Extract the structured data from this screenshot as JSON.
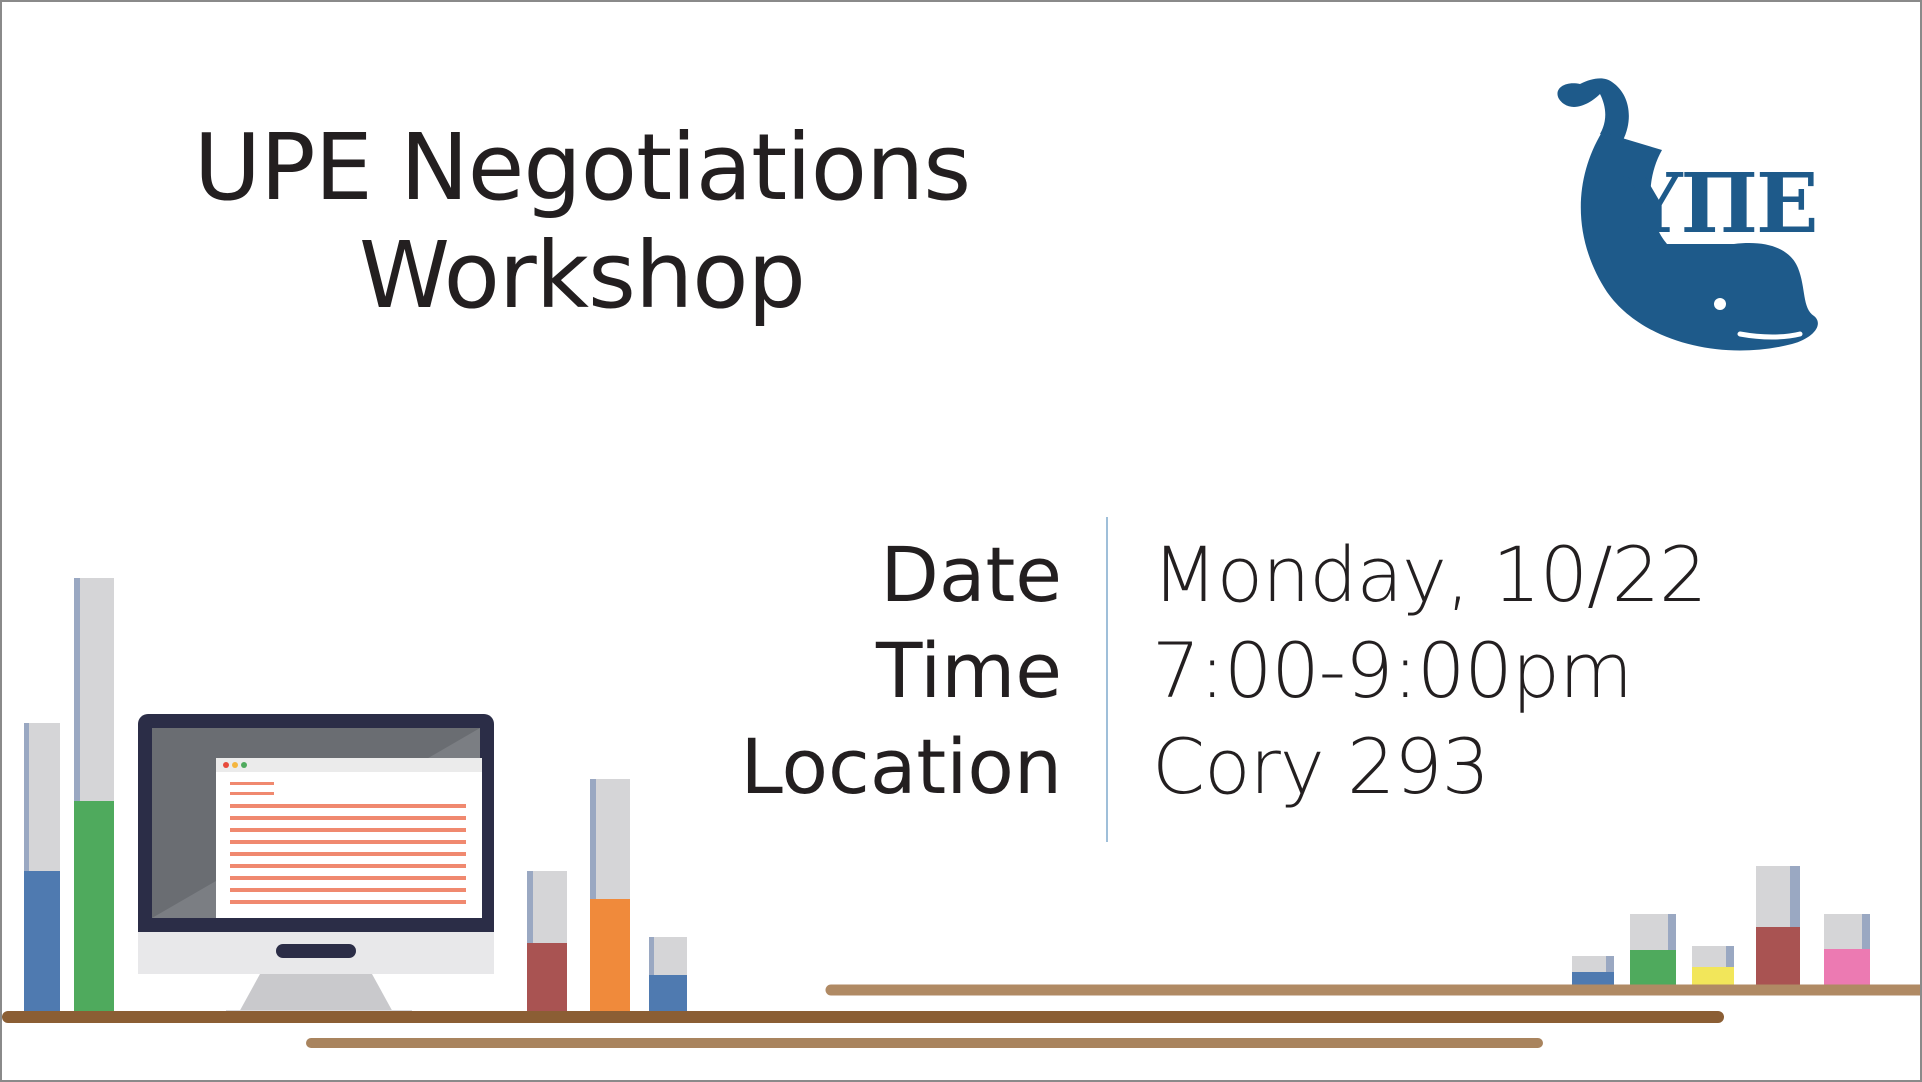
{
  "title": {
    "line1": "UPE Negotiations",
    "line2": "Workshop"
  },
  "details": {
    "labels": [
      "Date",
      "Time",
      "Location"
    ],
    "values": [
      "Monday, 10/22",
      "7:00-9:00pm",
      "Cory 293"
    ]
  },
  "logo": {
    "text": "ΥΠΕ",
    "icon": "whale-icon",
    "color": "#1e5a8a"
  },
  "colors": {
    "shelf": "#a9845e",
    "shelf_dark": "#8b5e34",
    "bar_track": "#d5d5d7",
    "bar_edge": "#9aa8c2",
    "blue": "#4f7ab0",
    "green": "#4faa5d",
    "orange": "#f08a3b",
    "red": "#a95352",
    "yellow": "#f2e65a",
    "pink": "#ec7ab2"
  }
}
